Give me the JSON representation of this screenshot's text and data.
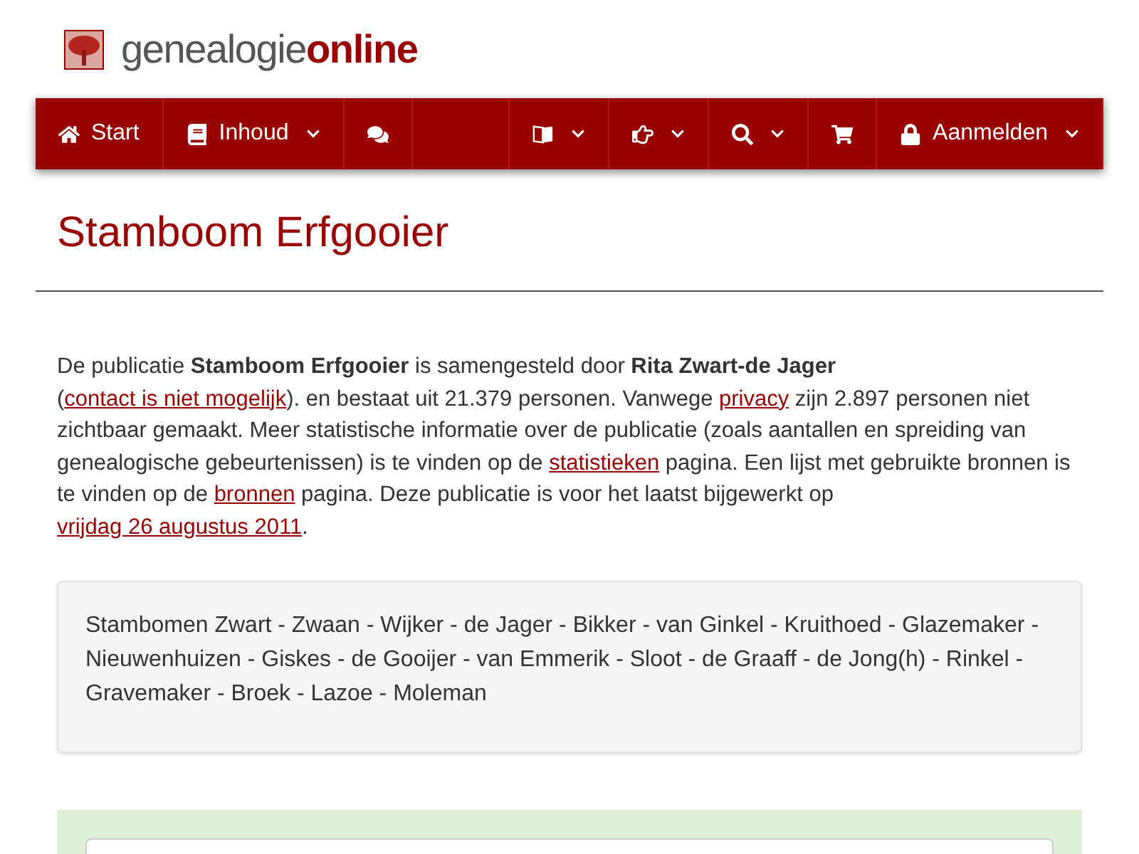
{
  "logo": {
    "text_plain": "genealogie",
    "text_bold": "online"
  },
  "nav": [
    {
      "kind": "home",
      "label": "Start",
      "dropdown": false
    },
    {
      "kind": "book",
      "label": "Inhoud",
      "dropdown": true
    },
    {
      "kind": "chat",
      "dropdown": false
    },
    {
      "kind": "spacer"
    },
    {
      "kind": "language",
      "dropdown": true
    },
    {
      "kind": "hand",
      "dropdown": true
    },
    {
      "kind": "search",
      "dropdown": true
    },
    {
      "kind": "cart",
      "dropdown": false
    },
    {
      "kind": "lock",
      "label": "Aanmelden",
      "dropdown": true
    }
  ],
  "page_title": "Stamboom Erfgooier",
  "intro": [
    {
      "kind": "text",
      "text": "De publicatie "
    },
    {
      "kind": "bold",
      "text": "Stamboom Erfgooier"
    },
    {
      "kind": "text",
      "text": " is samengesteld door "
    },
    {
      "kind": "bold",
      "text": "Rita Zwart-de Jager"
    },
    {
      "kind": "text",
      "text": " ("
    },
    {
      "kind": "link",
      "text": "contact is niet mogelijk"
    },
    {
      "kind": "text",
      "text": "). en bestaat uit 21.379 personen. Vanwege "
    },
    {
      "kind": "link",
      "text": "privacy"
    },
    {
      "kind": "text",
      "text": " zijn 2.897 personen niet zichtbaar gemaakt. Meer statistische informatie over de publicatie (zoals aantallen en spreiding van genealogische gebeurtenissen) is te vinden op de "
    },
    {
      "kind": "link",
      "text": "statistieken"
    },
    {
      "kind": "text",
      "text": " pagina. Een lijst met gebruikte bronnen is te vinden op de "
    },
    {
      "kind": "link",
      "text": "bronnen"
    },
    {
      "kind": "text",
      "text": " pagina. Deze publicatie is voor het laatst bijgewerkt op "
    },
    {
      "kind": "link",
      "text": "vrijdag 26 augustus 2011"
    },
    {
      "kind": "text",
      "text": "."
    }
  ],
  "description": "Stambomen Zwart - Zwaan - Wijker - de Jager - Bikker - van Ginkel - Kruithoed - Glazemaker - Nieuwenhuizen - Giskes - de Gooijer - van Emmerik - Sloot - de Graaff - de Jong(h) - Rinkel - Gravemaker - Broek - Lazoe - Moleman"
}
